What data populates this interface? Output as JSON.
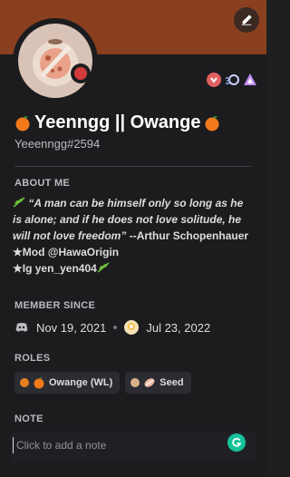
{
  "colors": {
    "banner": "#8a3f1f",
    "background": "#1c1c1f",
    "status_dnd": "#d23b3b",
    "role_wl": "#e67e22",
    "role_seed": "#d8b38a",
    "grammarly": "#15c39a"
  },
  "header": {
    "edit_icon": "pencil-icon",
    "avatar_icon": "orange-avatar"
  },
  "badges": [
    "heart-badge-icon",
    "speed-badge-icon",
    "nitro-triangle-badge-icon"
  ],
  "profile": {
    "display_name": "Yeenngg || Owange",
    "name_prefix_emoji": "orange-emoji",
    "name_suffix_emoji": "orange-emoji",
    "tag": "Yeeenngg#2594"
  },
  "about_me": {
    "title": "ABOUT ME",
    "quote_line1": "“A man can be himself only so long as he",
    "quote_line2": "is alone; and if he does not love solitude, he",
    "quote_line3": "will not love freedom”",
    "quote_author": "--Arthur Schopenhauer",
    "line_mod": "★Mod @HawaOrigin",
    "line_ig": "★Ig yen_yen404"
  },
  "member_since": {
    "title": "MEMBER SINCE",
    "discord_date": "Nov 19, 2021",
    "server_date": "Jul 23, 2022",
    "discord_icon": "discord-icon",
    "server_icon": "server-icon"
  },
  "roles": {
    "title": "ROLES",
    "items": [
      {
        "label": "Owange (WL)",
        "icon": "orange-role-icon"
      },
      {
        "label": "Seed",
        "icon": "seed-role-icon"
      }
    ]
  },
  "note": {
    "title": "NOTE",
    "placeholder": "Click to add a note",
    "value": "",
    "grammarly_icon": "grammarly-icon"
  }
}
